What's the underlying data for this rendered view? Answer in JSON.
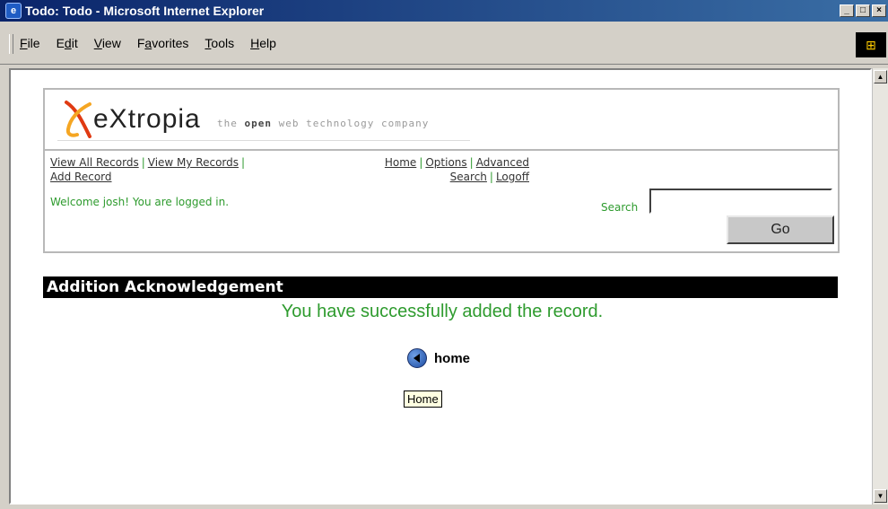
{
  "window": {
    "title": "Todo: Todo - Microsoft Internet Explorer",
    "minimize": "_",
    "maximize": "□",
    "close": "×"
  },
  "menubar": {
    "items": [
      {
        "accel": "F",
        "rest": "ile"
      },
      {
        "pre": "E",
        "accel": "d",
        "rest": "it"
      },
      {
        "accel": "V",
        "rest": "iew"
      },
      {
        "pre": "F",
        "accel": "a",
        "rest": "vorites"
      },
      {
        "accel": "T",
        "rest": "ools"
      },
      {
        "accel": "H",
        "rest": "elp"
      }
    ]
  },
  "logo": {
    "wordmark": "eXtropia",
    "tagline_pre": "the",
    "tagline_bold": "open",
    "tagline_post": "web technology company"
  },
  "nav": {
    "view_all": "View All Records",
    "view_my": "View My Records",
    "add_record": "Add Record",
    "home": "Home",
    "options": "Options",
    "advanced": "Advanced",
    "search": "Search",
    "logoff": "Logoff",
    "separator": "|"
  },
  "welcome": "Welcome josh! You are logged in.",
  "search": {
    "label": "Search",
    "value": "",
    "button": "Go"
  },
  "section_title": "Addition Acknowledgement",
  "message": "You have successfully added the record.",
  "home_link": {
    "label": "home",
    "tooltip": "Home"
  },
  "colors": {
    "accent_green": "#2e9b2e",
    "title_bar": "#0a246a"
  }
}
